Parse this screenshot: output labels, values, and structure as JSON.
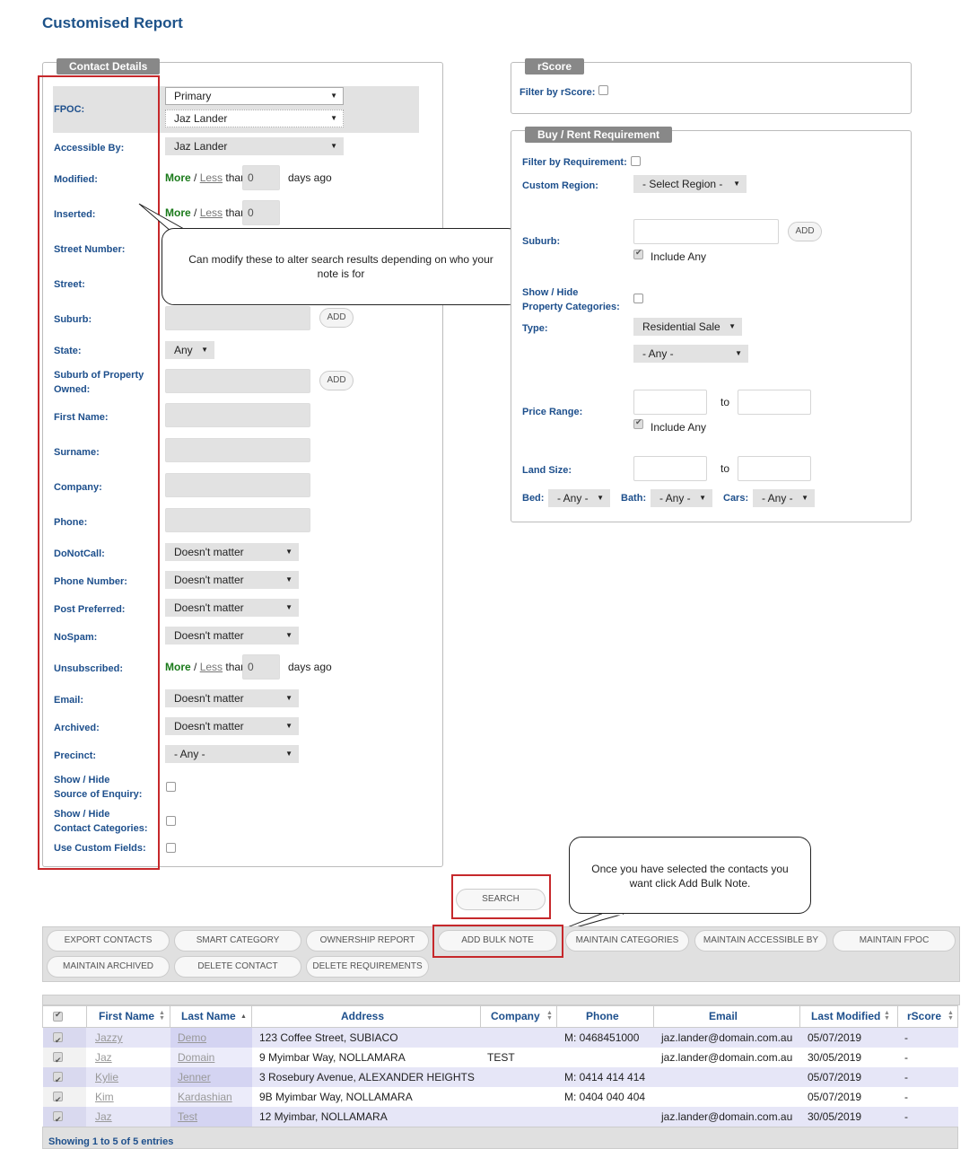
{
  "page_title": "Customised Report",
  "contact_details": {
    "legend": "Contact Details",
    "fpoc_label": "FPOC:",
    "fpoc_primary": "Primary",
    "fpoc_user": "Jaz Lander",
    "accessible_label": "Accessible By:",
    "accessible_value": "Jaz Lander",
    "modified_label": "Modified:",
    "inserted_label": "Inserted:",
    "street_number_label": "Street Number:",
    "street_label": "Street:",
    "suburb_label": "Suburb:",
    "state_label": "State:",
    "state_value": "Any",
    "suburb_owned_label_1": "Suburb of Property",
    "suburb_owned_label_2": "Owned:",
    "first_name_label": "First Name:",
    "surname_label": "Surname:",
    "company_label": "Company:",
    "phone_label": "Phone:",
    "donotcall_label": "DoNotCall:",
    "phone_number_label": "Phone Number:",
    "post_preferred_label": "Post Preferred:",
    "nospam_label": "NoSpam:",
    "unsubscribed_label": "Unsubscribed:",
    "email_label": "Email:",
    "archived_label": "Archived:",
    "precinct_label": "Precinct:",
    "precinct_value": "- Any -",
    "show_hide": "Show / Hide",
    "source_label": "Source of Enquiry:",
    "contact_cat_label": "Contact Categories:",
    "custom_fields_label": "Use Custom Fields:",
    "doesnt_matter": "Doesn't matter",
    "more": "More",
    "slash": "/",
    "less": "Less",
    "than": "than",
    "days_ago": "days ago",
    "zero": "0",
    "add": "ADD"
  },
  "rscore": {
    "legend": "rScore",
    "filter_label": "Filter by rScore:"
  },
  "buy_rent": {
    "legend": "Buy / Rent Requirement",
    "filter_label": "Filter by Requirement:",
    "custom_region_label": "Custom Region:",
    "region_value": "- Select Region -",
    "suburb_label": "Suburb:",
    "include_any": "Include Any",
    "show_hide": "Show / Hide",
    "prop_cat_label": "Property Categories:",
    "type_label": "Type:",
    "type_value": "Residential Sale",
    "type_sub_value": "- Any -",
    "price_label": "Price Range:",
    "to": "to",
    "land_label": "Land Size:",
    "bed_label": "Bed:",
    "bath_label": "Bath:",
    "cars_label": "Cars:",
    "any": "- Any -",
    "add": "ADD"
  },
  "callout_1": "Can modify these to alter search results depending on who your note is for",
  "callout_2": "Once you have selected the contacts you want click Add Bulk Note.",
  "search_button": "SEARCH",
  "toolbar": {
    "export": "EXPORT CONTACTS",
    "smart": "SMART CATEGORY",
    "ownership": "OWNERSHIP REPORT",
    "bulk_note": "ADD BULK NOTE",
    "maint_cat": "MAINTAIN CATEGORIES",
    "maint_access": "MAINTAIN ACCESSIBLE BY",
    "maint_fpoc": "MAINTAIN FPOC",
    "maint_arch": "MAINTAIN ARCHIVED",
    "delete_contact": "DELETE CONTACT",
    "delete_req": "DELETE REQUIREMENTS"
  },
  "table": {
    "headers": {
      "first": "First Name",
      "last": "Last Name",
      "address": "Address",
      "company": "Company",
      "phone": "Phone",
      "email": "Email",
      "modified": "Last Modified",
      "rscore": "rScore"
    },
    "rows": [
      {
        "first": "Jazzy",
        "last": "Demo",
        "address": "123 Coffee Street, SUBIACO",
        "company": "",
        "phone": "M: 0468451000",
        "email": "jaz.lander@domain.com.au",
        "modified": "05/07/2019",
        "rscore": "-"
      },
      {
        "first": "Jaz",
        "last": "Domain",
        "address": "9 Myimbar Way, NOLLAMARA",
        "company": "TEST",
        "phone": "",
        "email": "jaz.lander@domain.com.au",
        "modified": "30/05/2019",
        "rscore": "-"
      },
      {
        "first": "Kylie",
        "last": "Jenner",
        "address": "3 Rosebury Avenue, ALEXANDER HEIGHTS",
        "company": "",
        "phone": "M: 0414 414 414",
        "email": "",
        "modified": "05/07/2019",
        "rscore": "-"
      },
      {
        "first": "Kim",
        "last": "Kardashian",
        "address": "9B Myimbar Way, NOLLAMARA",
        "company": "",
        "phone": "M: 0404 040 404",
        "email": "",
        "modified": "05/07/2019",
        "rscore": "-"
      },
      {
        "first": "Jaz",
        "last": "Test",
        "address": "12 Myimbar, NOLLAMARA",
        "company": "",
        "phone": "",
        "email": "jaz.lander@domain.com.au",
        "modified": "30/05/2019",
        "rscore": "-"
      }
    ],
    "footer": "Showing 1 to 5 of 5 entries"
  }
}
